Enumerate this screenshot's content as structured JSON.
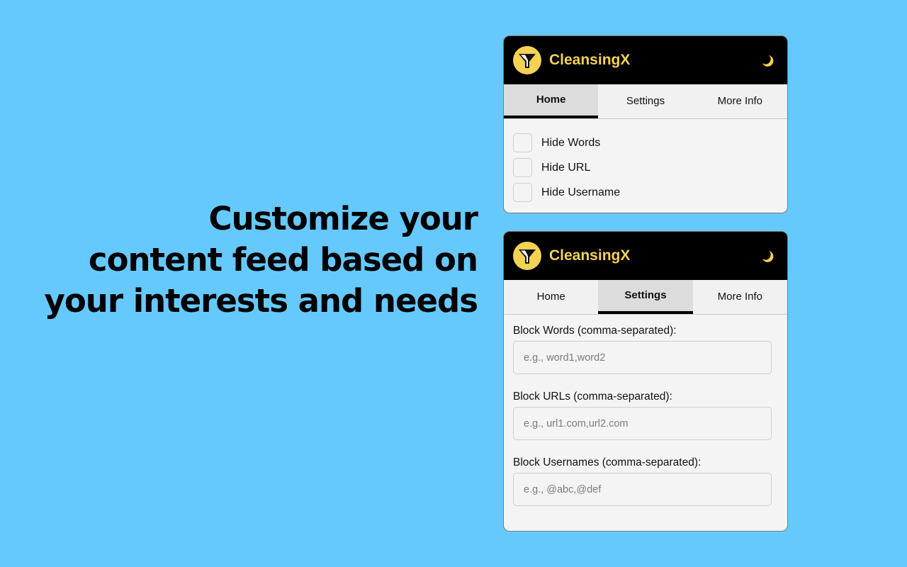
{
  "headline": {
    "lines": [
      "Customize your",
      "content feed based on",
      "your interests and needs"
    ]
  },
  "brand": {
    "name": "CleansingX",
    "logo_icon": "funnel-filter-icon",
    "theme_icon": "crescent-moon-icon",
    "accent_color": "#f5d252"
  },
  "tabs": [
    {
      "label": "Home"
    },
    {
      "label": "Settings"
    },
    {
      "label": "More Info"
    }
  ],
  "home_panel": {
    "active_tab": "Home",
    "checkboxes": [
      {
        "label": "Hide Words",
        "checked": false
      },
      {
        "label": "Hide URL",
        "checked": false
      },
      {
        "label": "Hide Username",
        "checked": false
      }
    ]
  },
  "settings_panel": {
    "active_tab": "Settings",
    "fields": [
      {
        "label": "Block Words (comma-separated):",
        "value": "",
        "placeholder": "e.g., word1,word2"
      },
      {
        "label": "Block URLs (comma-separated):",
        "value": "",
        "placeholder": "e.g., url1.com,url2.com"
      },
      {
        "label": "Block Usernames (comma-separated):",
        "value": "",
        "placeholder": "e.g., @abc,@def"
      }
    ]
  }
}
